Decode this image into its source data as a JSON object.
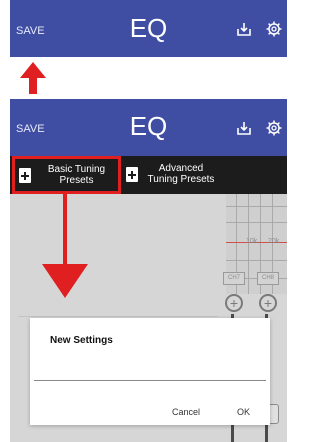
{
  "top_bar": {
    "save_label": "SAVE",
    "title": "EQ",
    "export_icon": "export-icon",
    "settings_icon": "gear-icon"
  },
  "bottom_bar": {
    "save_label": "SAVE",
    "title": "EQ",
    "export_icon": "export-icon",
    "settings_icon": "gear-icon"
  },
  "presets": {
    "basic_label": "Basic Tuning Presets",
    "advanced_label": "Advanced Tuning Presets"
  },
  "eq_panel": {
    "hz_label": "10k",
    "hz_label2": "20k",
    "channels": [
      "CH7",
      "CH8"
    ]
  },
  "dialog": {
    "title": "New Settings",
    "input_value": "",
    "cancel_label": "Cancel",
    "ok_label": "OK"
  },
  "colors": {
    "header": "#3f4ea3",
    "highlight": "#e02020",
    "preset_bar": "#1c1c1c"
  }
}
